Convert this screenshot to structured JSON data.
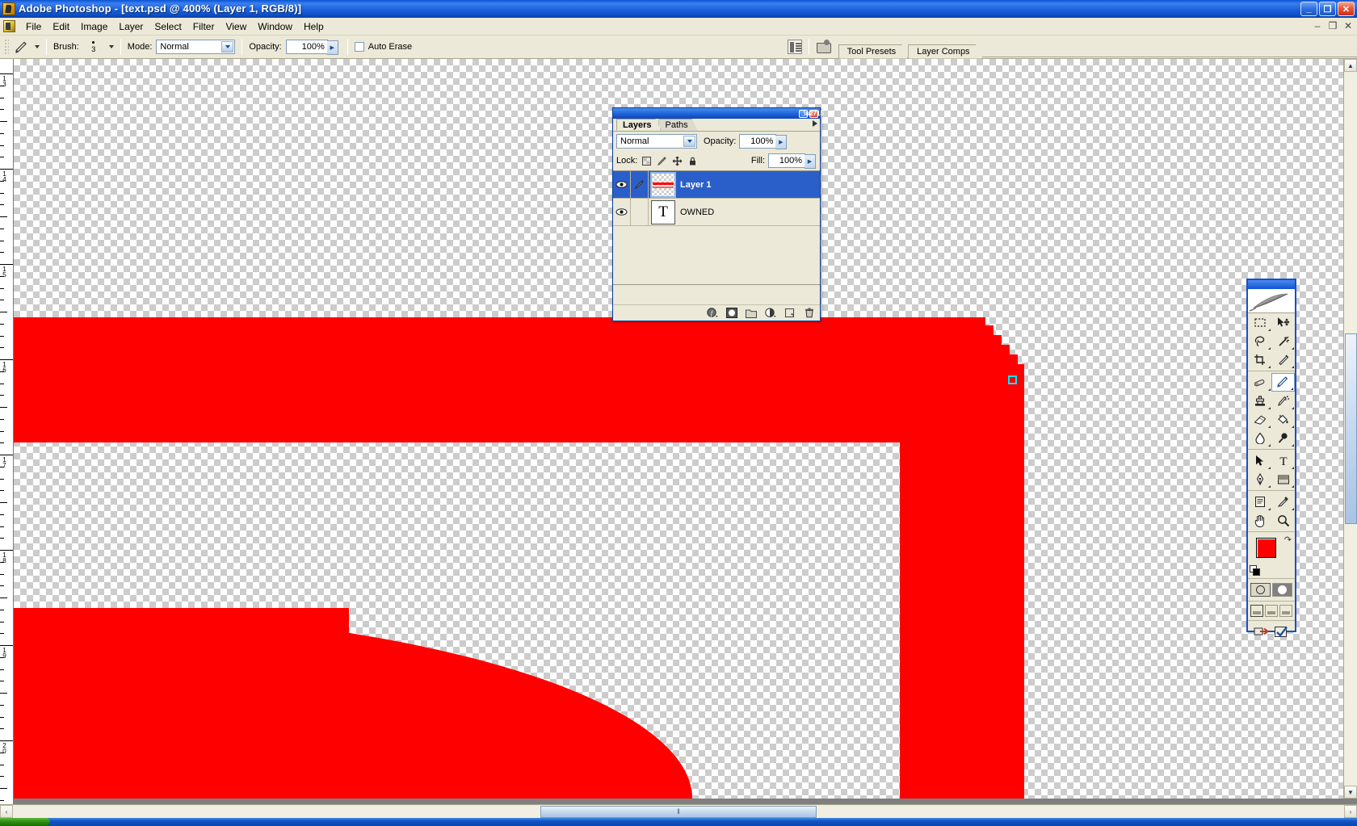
{
  "window": {
    "app_title": "Adobe Photoshop",
    "document_title": "[text.psd @ 400% (Layer 1, RGB/8)]",
    "full_title": "Adobe Photoshop - [text.psd @ 400% (Layer 1, RGB/8)]",
    "minimize_label": "_",
    "restore_label": "❐",
    "close_label": "✕",
    "mdi_minimize": "–",
    "mdi_restore": "❐",
    "mdi_close": "✕"
  },
  "menubar": {
    "items": [
      {
        "label": "File"
      },
      {
        "label": "Edit"
      },
      {
        "label": "Image"
      },
      {
        "label": "Layer"
      },
      {
        "label": "Select"
      },
      {
        "label": "Filter"
      },
      {
        "label": "View"
      },
      {
        "label": "Window"
      },
      {
        "label": "Help"
      }
    ]
  },
  "options_bar": {
    "tool": "pencil-tool",
    "brush_label": "Brush:",
    "brush_size": "3",
    "mode_label": "Mode:",
    "mode_value": "Normal",
    "opacity_label": "Opacity:",
    "opacity_value": "100%",
    "auto_erase_label": "Auto Erase",
    "auto_erase_checked": false,
    "dock_tabs": [
      {
        "label": "Tool Presets"
      },
      {
        "label": "Layer Comps"
      }
    ]
  },
  "layers_palette": {
    "tabs": [
      {
        "label": "Layers",
        "active": true
      },
      {
        "label": "Paths",
        "active": false
      }
    ],
    "blend_mode": "Normal",
    "opacity_label": "Opacity:",
    "opacity_value": "100%",
    "lock_label": "Lock:",
    "lock_buttons": [
      {
        "name": "lock-transparent-pixels-icon"
      },
      {
        "name": "lock-image-pixels-icon"
      },
      {
        "name": "lock-position-icon"
      },
      {
        "name": "lock-all-icon"
      }
    ],
    "fill_label": "Fill:",
    "fill_value": "100%",
    "layers": [
      {
        "name": "Layer 1",
        "selected": true,
        "visible": true,
        "type": "pixel",
        "has_brush_icon": true
      },
      {
        "name": "OWNED",
        "selected": false,
        "visible": true,
        "type": "text",
        "thumb_glyph": "T",
        "has_brush_icon": false
      }
    ],
    "footer_buttons": [
      {
        "name": "layer-style-button",
        "glyph": "ƒ"
      },
      {
        "name": "add-layer-mask-button",
        "glyph": "◯"
      },
      {
        "name": "new-group-button",
        "glyph": "▭"
      },
      {
        "name": "new-adjustment-layer-button",
        "glyph": "◑"
      },
      {
        "name": "new-layer-button",
        "glyph": "⧉"
      },
      {
        "name": "delete-layer-button",
        "glyph": "🗑"
      }
    ]
  },
  "toolbox": {
    "active_tool": "pencil-tool",
    "rows": [
      [
        {
          "name": "rectangular-marquee-tool",
          "glyph": "marquee"
        },
        {
          "name": "move-tool",
          "glyph": "move"
        }
      ],
      [
        {
          "name": "lasso-tool",
          "glyph": "lasso"
        },
        {
          "name": "magic-wand-tool",
          "glyph": "wand"
        }
      ],
      [
        {
          "name": "crop-tool",
          "glyph": "crop"
        },
        {
          "name": "slice-tool",
          "glyph": "slice"
        }
      ],
      [
        {
          "name": "healing-brush-tool",
          "glyph": "heal"
        },
        {
          "name": "pencil-tool",
          "glyph": "pencil"
        }
      ],
      [
        {
          "name": "clone-stamp-tool",
          "glyph": "stamp"
        },
        {
          "name": "history-brush-tool",
          "glyph": "historybrush"
        }
      ],
      [
        {
          "name": "eraser-tool",
          "glyph": "eraser"
        },
        {
          "name": "paint-bucket-tool",
          "glyph": "bucket"
        }
      ],
      [
        {
          "name": "blur-tool",
          "glyph": "blur"
        },
        {
          "name": "dodge-tool",
          "glyph": "dodge"
        }
      ],
      [
        {
          "name": "path-selection-tool",
          "glyph": "arrow"
        },
        {
          "name": "type-tool",
          "glyph": "T"
        }
      ],
      [
        {
          "name": "pen-tool",
          "glyph": "pen"
        },
        {
          "name": "rectangle-shape-tool",
          "glyph": "shape"
        }
      ],
      [
        {
          "name": "notes-tool",
          "glyph": "notes"
        },
        {
          "name": "eyedropper-tool",
          "glyph": "eyedropper"
        }
      ],
      [
        {
          "name": "hand-tool",
          "glyph": "hand"
        },
        {
          "name": "zoom-tool",
          "glyph": "zoom"
        }
      ]
    ],
    "foreground_color": "#ff0000",
    "background_color": "#ff9900",
    "swap_colors_label": "⤵",
    "quickmask_modes": [
      {
        "name": "standard-mode-button",
        "selected": true
      },
      {
        "name": "quick-mask-mode-button",
        "selected": false
      }
    ],
    "screen_modes": [
      {
        "name": "standard-screen-mode-button",
        "selected": true
      },
      {
        "name": "full-screen-with-menubar-button",
        "selected": false
      },
      {
        "name": "full-screen-mode-button",
        "selected": false
      }
    ],
    "jump_buttons": [
      {
        "name": "jump-to-imageready-button"
      },
      {
        "name": "imageready-check-button"
      }
    ]
  },
  "rulers": {
    "unit": "inches",
    "vertical_labels": [
      "13",
      "14",
      "15",
      "16",
      "17",
      "18",
      "19",
      "20"
    ]
  },
  "canvas": {
    "zoom": "400%",
    "background": "transparent-checker",
    "shape_color": "#ff0000",
    "pixel_cursor_color": "#ff0000",
    "pixel_cursor_outline": "#00e5ff"
  },
  "scrollbars": {
    "left_arrow": "‹",
    "right_arrow": "›",
    "up_arrow": "▲",
    "down_arrow": "▼",
    "h_thumb_grip": "‖",
    "v_thumb_grip": "═"
  }
}
